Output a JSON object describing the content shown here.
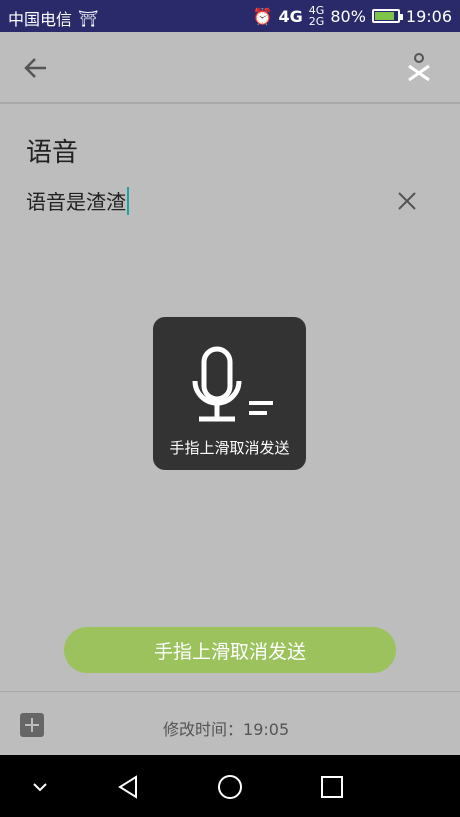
{
  "status_bar": {
    "carrier": "中国电信",
    "network": "4G",
    "battery": "80%",
    "time": "19:06"
  },
  "app_bar": {
    "back_icon": "back-arrow-icon",
    "action_icon": "sketch-close-icon"
  },
  "note": {
    "title": "语音",
    "content": "语音是渣渣",
    "clear_icon": "close-icon"
  },
  "voice_overlay": {
    "hint": "手指上滑取消发送",
    "icon": "microphone-icon"
  },
  "voice_button": {
    "label": "手指上滑取消发送",
    "color": "#9cc25e"
  },
  "bottom_bar": {
    "add_icon": "add-icon",
    "modified_label": "修改时间：",
    "modified_time": "19:05"
  },
  "nav_bar": {
    "down": "chevron-down-icon",
    "back": "back-triangle-icon",
    "home": "home-circle-icon",
    "recents": "recents-square-icon"
  }
}
